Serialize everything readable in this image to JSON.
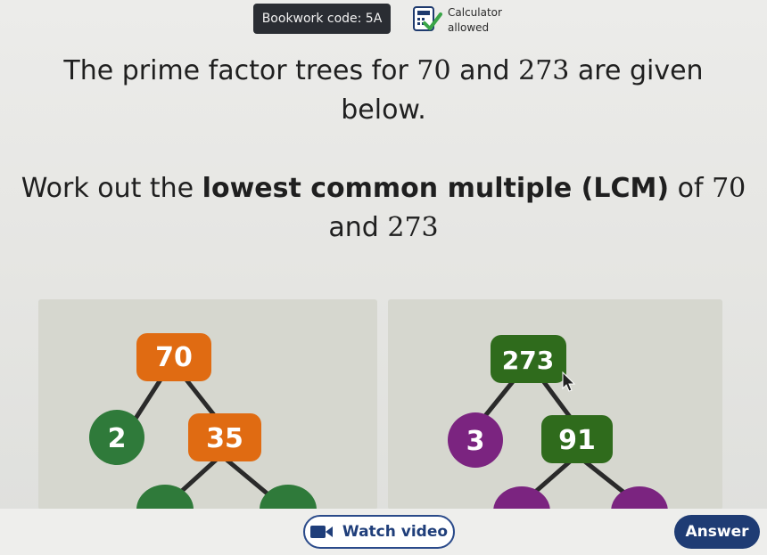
{
  "header": {
    "bookwork_label": "Bookwork code: 5A",
    "calculator_line1": "Calculator",
    "calculator_line2": "allowed",
    "calculator_icon": "calculator-check-icon"
  },
  "question": {
    "line1_pre": "The prime factor trees for ",
    "line1_num1": "70",
    "line1_mid": " and ",
    "line1_num2": "273",
    "line1_post": " are given",
    "line2": "below.",
    "work_pre": "Work out the ",
    "work_bold": "lowest common multiple (LCM)",
    "work_of": " of ",
    "work_num1": "70",
    "work_and": "and ",
    "work_num2": "273"
  },
  "tree_70": {
    "root": "70",
    "left": "2",
    "right": "35",
    "colors": {
      "root": "#e06b12",
      "left": "#2f7a3a",
      "right": "#e06b12",
      "children": "#2f7a3a"
    }
  },
  "tree_273": {
    "root": "273",
    "left": "3",
    "right": "91",
    "colors": {
      "root": "#2f6b1c",
      "left": "#7b2480",
      "right": "#2f6b1c",
      "children": "#7b2480"
    }
  },
  "footer": {
    "watch_video_label": "Watch video",
    "watch_video_icon": "video-camera-icon",
    "answer_label": "Answer"
  }
}
